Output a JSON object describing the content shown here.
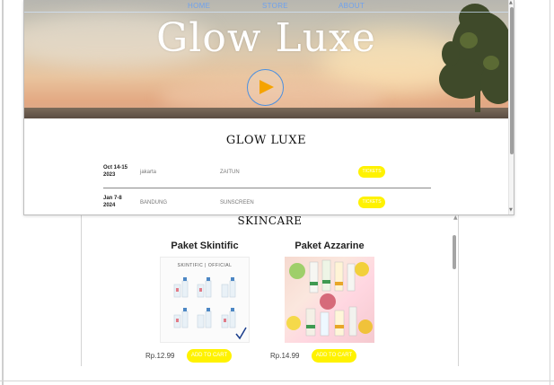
{
  "concert_page": {
    "nav": {
      "home": "HOME",
      "store": "STORE",
      "about": "ABOUT"
    },
    "hero_title": "Glow Luxe",
    "section_heading": "GLOW LUXE",
    "tour": [
      {
        "date": "Oct 14-15\n2023",
        "city": "jakarta",
        "venue": "ZAITUN",
        "button": "TICKETS"
      },
      {
        "date": "Jan 7-8\n2024",
        "city": "BANDUNG",
        "venue": "SUNSCREEN",
        "button": "TICKETS"
      }
    ]
  },
  "skincare_page": {
    "heading": "SKINCARE",
    "products": [
      {
        "name": "Paket Skintific",
        "brand": "SKINTIFIC  |  OFFICIAL",
        "price": "Rp.12.99",
        "button": "ADD TO CART"
      },
      {
        "name": "Paket Azzarine",
        "price": "Rp.14.99",
        "button": "ADD TO CART"
      }
    ]
  },
  "colors": {
    "accent_button": "#fff200",
    "nav_link": "#6fa2ee",
    "play_ring": "#4a8fe0",
    "play_triangle": "#f5a300"
  },
  "icons": [
    "play-icon",
    "scroll-up-icon",
    "scroll-down-icon"
  ]
}
